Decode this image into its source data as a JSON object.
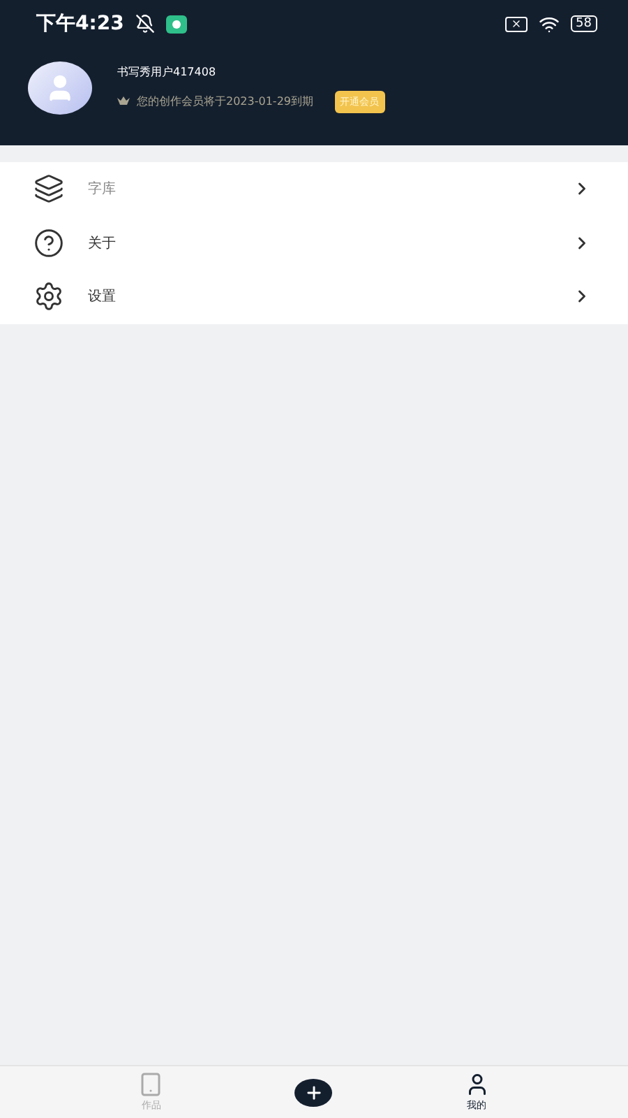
{
  "status_bar": {
    "time": "下午4:23",
    "battery": "58"
  },
  "profile": {
    "username": "书写秀用户417408",
    "membership_notice": "您的创作会员将于2023-01-29到期",
    "upgrade_button": "开通会员"
  },
  "menu": [
    {
      "label": "字库",
      "kind": "layers"
    },
    {
      "label": "关于",
      "kind": "help"
    },
    {
      "label": "设置",
      "kind": "settings"
    }
  ],
  "tab_bar": [
    {
      "label": "作品",
      "kind": "tab",
      "selected": false
    },
    {
      "kind": "add"
    },
    {
      "label": "我的",
      "kind": "tab",
      "selected": true
    }
  ]
}
